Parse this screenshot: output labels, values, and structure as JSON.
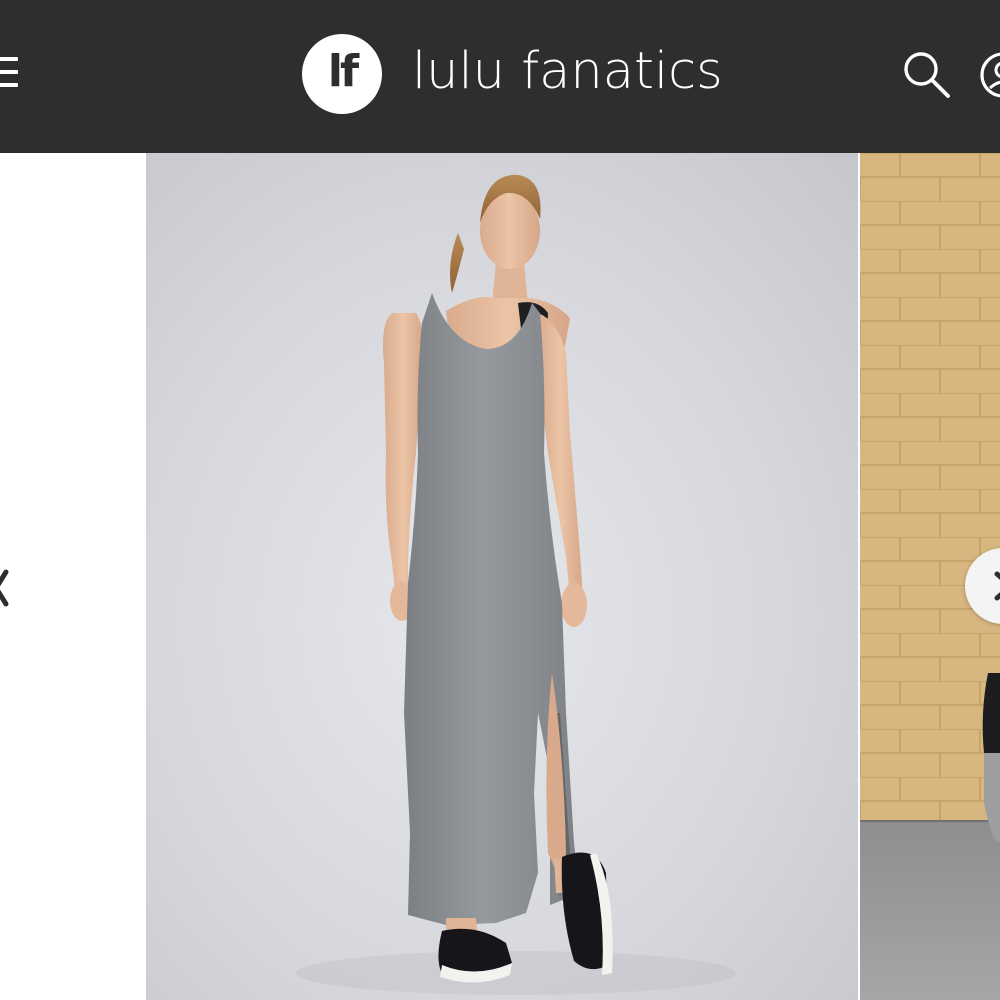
{
  "header": {
    "logo_text": "lf",
    "brand_name": "lulu fanatics",
    "background_color": "#2e2e2e",
    "menu_icon": "hamburger-menu-icon",
    "search_icon": "search-icon",
    "account_icon": "user-account-icon"
  },
  "gallery": {
    "slides": [
      {
        "label": "model-grey-racerback-maxi-dress",
        "dress_color": "#8a8d90"
      },
      {
        "label": "model-in-front-of-brick-wall",
        "wall_color": "#d9b77d"
      }
    ],
    "prev_icon": "chevron-left-icon",
    "next_icon": "chevron-right-icon"
  }
}
